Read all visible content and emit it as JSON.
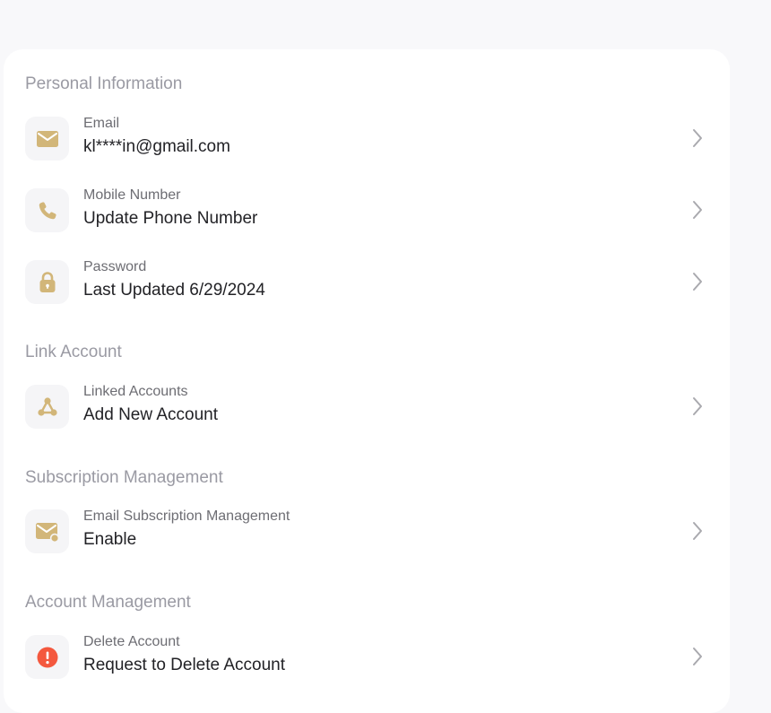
{
  "colors": {
    "accent_gold": "#d2b679",
    "danger": "#f4583e",
    "section_title": "#9a9aa3",
    "label": "#6d6d73",
    "value": "#222226"
  },
  "sections": {
    "personal": {
      "title": "Personal Information",
      "email": {
        "label": "Email",
        "value": "kl****in@gmail.com",
        "icon": "envelope-icon"
      },
      "mobile": {
        "label": "Mobile Number",
        "value": "Update Phone Number",
        "icon": "phone-icon"
      },
      "password": {
        "label": "Password",
        "value": "Last Updated 6/29/2024",
        "icon": "lock-icon"
      }
    },
    "link": {
      "title": "Link Account",
      "linked": {
        "label": "Linked Accounts",
        "value": "Add New Account",
        "icon": "share-nodes-icon"
      }
    },
    "subscription": {
      "title": "Subscription Management",
      "email_sub": {
        "label": "Email Subscription Management",
        "value": "Enable",
        "icon": "mail-badge-icon"
      }
    },
    "account": {
      "title": "Account Management",
      "delete": {
        "label": "Delete Account",
        "value": "Request to Delete Account",
        "icon": "alert-circle-icon"
      }
    }
  }
}
